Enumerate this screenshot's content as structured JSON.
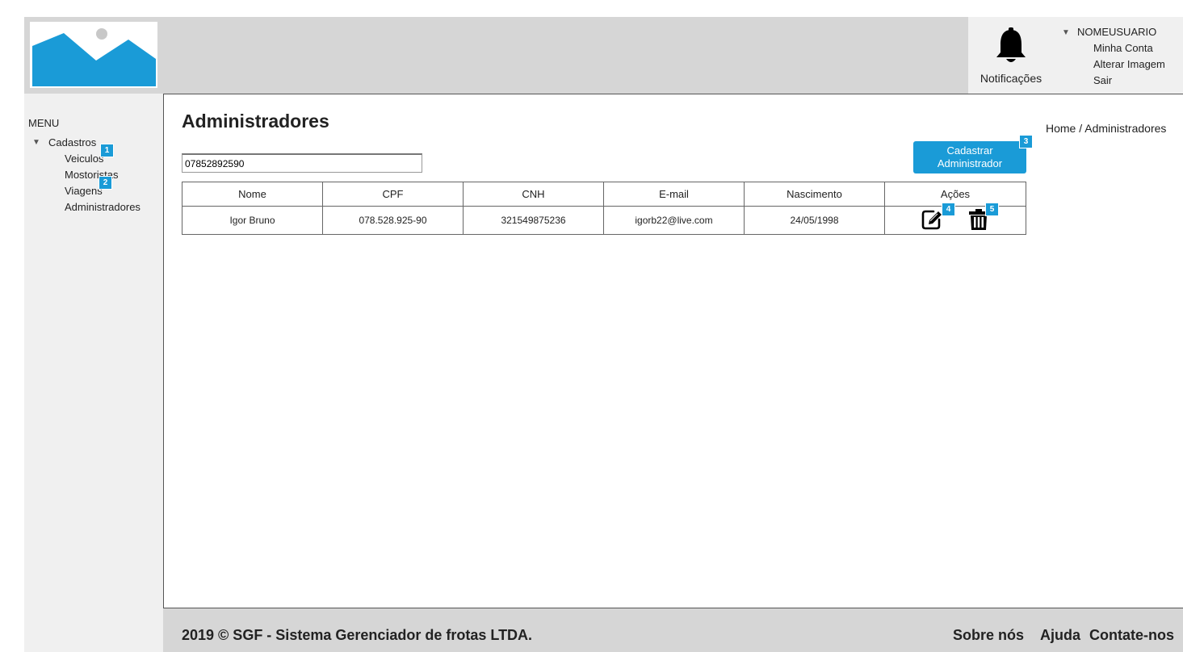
{
  "header": {
    "notifications_label": "Notificações",
    "user": {
      "name": "NOMEUSUARIO",
      "menu": [
        "Minha Conta",
        "Alterar Imagem",
        "Sair"
      ]
    }
  },
  "sidebar": {
    "title": "MENU",
    "group_label": "Cadastros",
    "items": [
      {
        "label": "Veiculos"
      },
      {
        "label": "Mostoristas"
      },
      {
        "label": "Viagens"
      },
      {
        "label": "Administradores"
      }
    ]
  },
  "badges": [
    "1",
    "2",
    "3",
    "4",
    "5"
  ],
  "main": {
    "title": "Administradores",
    "breadcrumb": "Home / Administradores",
    "search_value": "07852892590",
    "add_button_label": "Cadastrar\nAdministrador",
    "table": {
      "headers": [
        "Nome",
        "CPF",
        "CNH",
        "E-mail",
        "Nascimento",
        "Ações"
      ],
      "rows": [
        {
          "nome": "Igor Bruno",
          "cpf": "078.528.925-90",
          "cnh": "321549875236",
          "email": "igorb22@live.com",
          "nascimento": "24/05/1998"
        }
      ]
    }
  },
  "footer": {
    "copyright": "2019 © SGF - Sistema Gerenciador de frotas LTDA.",
    "links": [
      "Sobre nós",
      "Ajuda",
      "Contate-nos"
    ]
  },
  "colors": {
    "accent": "#1a9bd7",
    "header_bg": "#d6d6d6",
    "sidebar_bg": "#f0f0f0"
  },
  "icons": {
    "logo": "image-placeholder-icon",
    "notifications": "bell-icon",
    "edit": "edit-icon",
    "delete": "trash-icon"
  }
}
